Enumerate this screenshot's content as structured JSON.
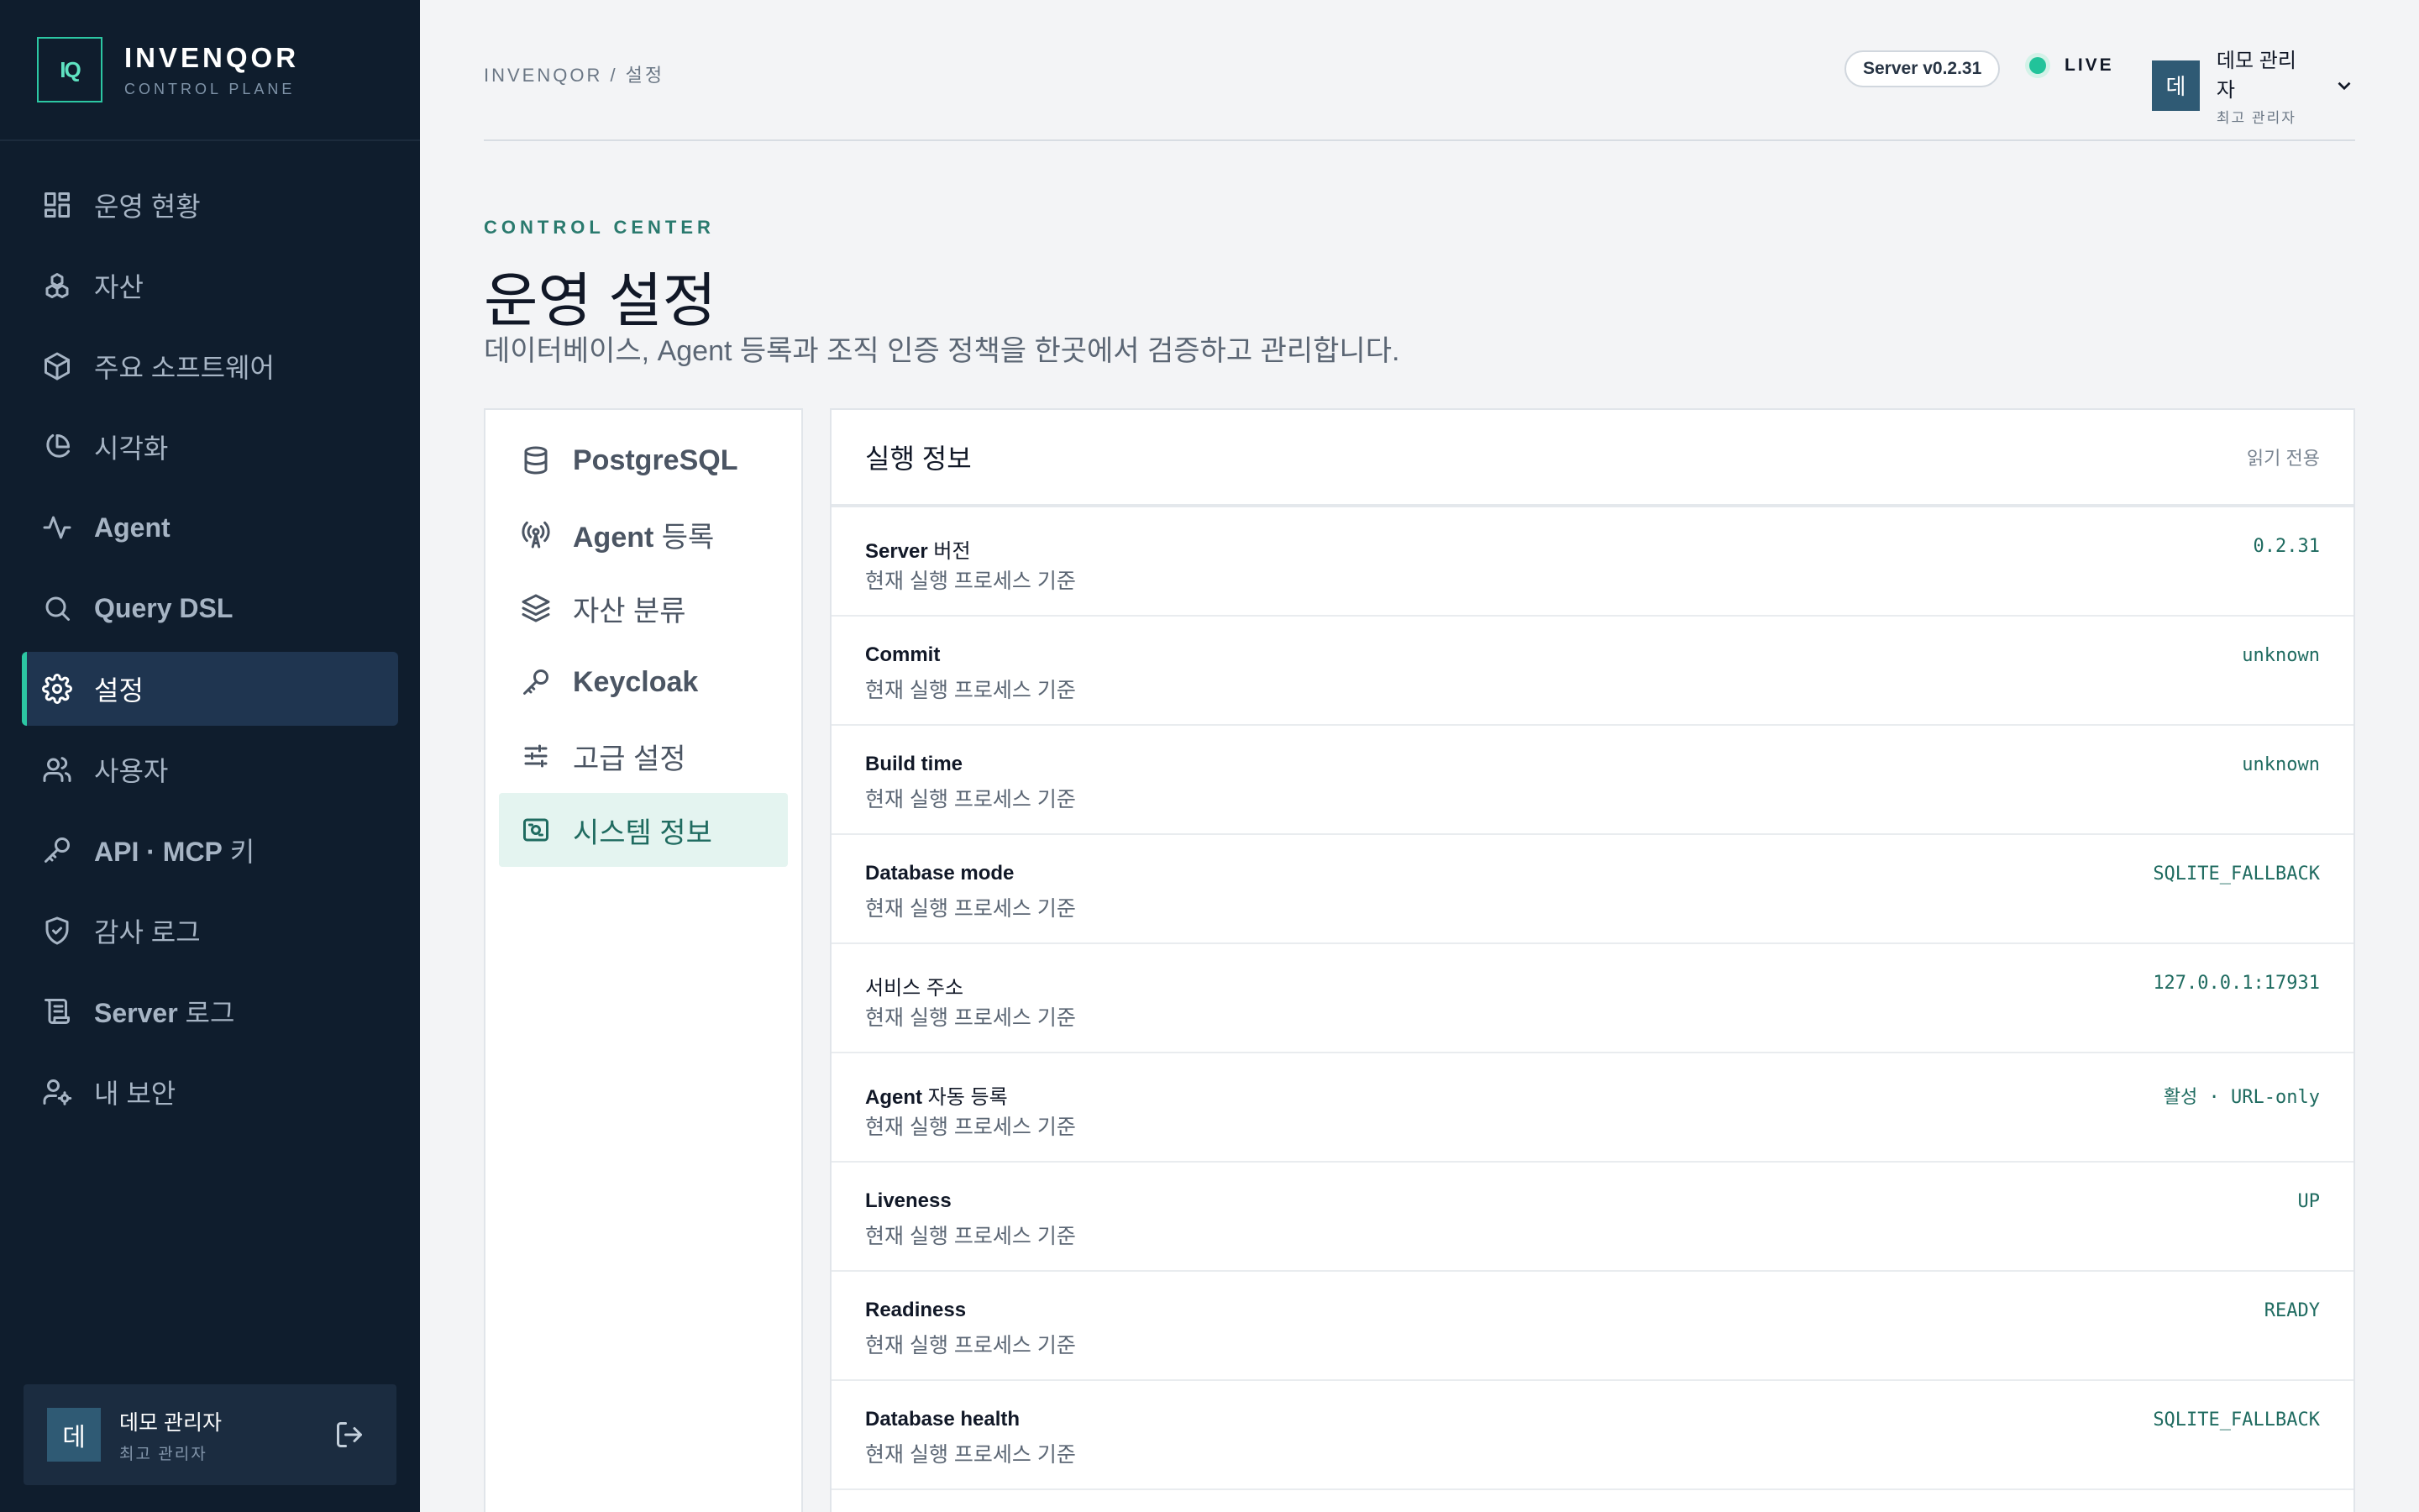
{
  "brand": {
    "logo": "IQ",
    "name": "INVENQOR",
    "subtitle": "CONTROL PLANE"
  },
  "sidebar": {
    "items": [
      {
        "label": "운영 현황",
        "icon": "dashboard-icon",
        "active": false
      },
      {
        "label": "자산",
        "icon": "boxes-icon",
        "active": false
      },
      {
        "label": "주요 소프트웨어",
        "icon": "package-icon",
        "active": false
      },
      {
        "label": "시각화",
        "icon": "pie-chart-icon",
        "active": false
      },
      {
        "label": "Agent",
        "icon": "activity-icon",
        "active": false
      },
      {
        "label": "Query DSL",
        "icon": "search-icon",
        "active": false
      },
      {
        "label": "설정",
        "icon": "gear-icon",
        "active": true
      },
      {
        "label": "사용자",
        "icon": "users-icon",
        "active": false
      },
      {
        "label_bold": "API · MCP",
        "label_rest": " 키",
        "icon": "key-icon",
        "active": false
      },
      {
        "label": "감사 로그",
        "icon": "shield-check-icon",
        "active": false
      },
      {
        "label_bold": "Server",
        "label_rest": " 로그",
        "icon": "scroll-icon",
        "active": false
      },
      {
        "label": "내 보안",
        "icon": "user-cog-icon",
        "active": false
      }
    ]
  },
  "user": {
    "avatar": "데",
    "name": "데모 관리자",
    "role": "최고 관리자"
  },
  "topbar": {
    "breadcrumb": "INVENQOR / 설정",
    "server_version": "Server v0.2.31",
    "status": "LIVE",
    "user_avatar": "데",
    "user_name": "데모 관리자",
    "user_role": "최고 관리자"
  },
  "page": {
    "eyebrow": "CONTROL CENTER",
    "title": "운영 설정",
    "description": "데이터베이스, Agent 등록과 조직 인증 정책을 한곳에서 검증하고 관리합니다."
  },
  "settings_menu": {
    "items": [
      {
        "bold": "PostgreSQL",
        "rest": "",
        "icon": "database-icon",
        "active": false
      },
      {
        "bold": "Agent",
        "rest": " 등록",
        "icon": "antenna-icon",
        "active": false
      },
      {
        "bold": "",
        "rest": "자산 분류",
        "icon": "layers-icon",
        "active": false
      },
      {
        "bold": "Keycloak",
        "rest": "",
        "icon": "key-icon",
        "active": false
      },
      {
        "bold": "",
        "rest": "고급 설정",
        "icon": "sliders-icon",
        "active": false
      },
      {
        "bold": "",
        "rest": "시스템 정보",
        "icon": "system-info-icon",
        "active": true
      }
    ]
  },
  "info_panel": {
    "title": "실행 정보",
    "badge": "읽기 전용",
    "rows": [
      {
        "label_bold": "Server",
        "label_rest": " 버전",
        "sub": "현재 실행 프로세스 기준",
        "value": "0.2.31"
      },
      {
        "label_bold": "Commit",
        "label_rest": "",
        "sub": "현재 실행 프로세스 기준",
        "value": "unknown"
      },
      {
        "label_bold": "Build time",
        "label_rest": "",
        "sub": "현재 실행 프로세스 기준",
        "value": "unknown"
      },
      {
        "label_bold": "Database mode",
        "label_rest": "",
        "sub": "현재 실행 프로세스 기준",
        "value": "SQLITE_FALLBACK"
      },
      {
        "label_bold": "",
        "label_rest": "서비스 주소",
        "sub": "현재 실행 프로세스 기준",
        "value": "127.0.0.1:17931"
      },
      {
        "label_bold": "Agent",
        "label_rest": " 자동 등록",
        "sub": "현재 실행 프로세스 기준",
        "value": "활성 · URL-only"
      },
      {
        "label_bold": "Liveness",
        "label_rest": "",
        "sub": "현재 실행 프로세스 기준",
        "value": "UP"
      },
      {
        "label_bold": "Readiness",
        "label_rest": "",
        "sub": "현재 실행 프로세스 기준",
        "value": "READY"
      },
      {
        "label_bold": "Database health",
        "label_rest": "",
        "sub": "현재 실행 프로세스 기준",
        "value": "SQLITE_FALLBACK"
      }
    ]
  },
  "colors": {
    "sidebar_bg": "#0f1d2d",
    "accent": "#2cc7a3",
    "active_nav": "#1f3550",
    "value_text": "#1f6b60"
  }
}
